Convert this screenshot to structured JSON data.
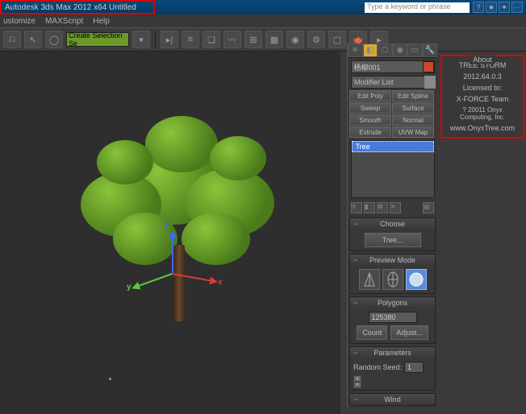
{
  "title": "Autodesk 3ds Max  2012 x64    Untitled",
  "search_placeholder": "Type a keyword or phrase",
  "menu": {
    "items": [
      "ustomize",
      "MAXScript",
      "Help"
    ]
  },
  "selection_mode": "Create Selection Se",
  "cmd": {
    "object_name": "杨柳001",
    "modifier_list": "Modifier List",
    "buttons": [
      "Edit Poly",
      "Edit Spline",
      "Sweep",
      "Surface",
      "Smooth",
      "Normal",
      "Extrude",
      "UVW Map"
    ],
    "stack_item": "Tree"
  },
  "rollouts": {
    "choose": {
      "title": "Choose",
      "btn": "Tree..."
    },
    "preview": {
      "title": "Preview Mode"
    },
    "polygons": {
      "title": "Polygons",
      "value": "125380",
      "count": "Count",
      "adjust": "Adjust..."
    },
    "parameters": {
      "title": "Parameters",
      "seed_label": "Random Seed:",
      "seed_value": "1"
    },
    "wind": {
      "title": "Wind"
    }
  },
  "about": {
    "header": "About",
    "lines": [
      "TREE STORM",
      "2012.64.0.3",
      "Licensed to:",
      "X-FORCE Team",
      "? 20011 Onyx Computing, Inc.",
      "www.OnyxTree.com"
    ]
  }
}
